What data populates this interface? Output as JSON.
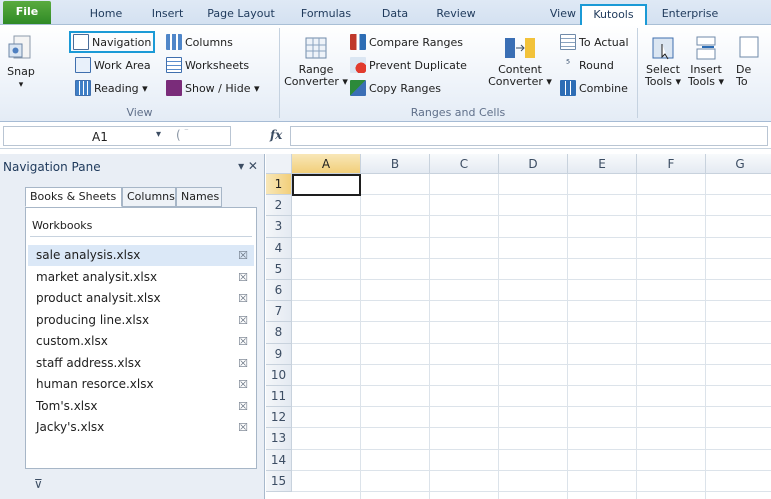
{
  "tabs": [
    "File",
    "Home",
    "Insert",
    "Page Layout",
    "Formulas",
    "Data",
    "Review",
    "View",
    "Kutools",
    "Enterprise"
  ],
  "ribbon": {
    "view_group": {
      "snap": "Snap",
      "navigation": "Navigation",
      "columns": "Columns",
      "work_area": "Work Area",
      "worksheets": "Worksheets",
      "reading": "Reading ▾",
      "show_hide": "Show / Hide ▾",
      "label": "View"
    },
    "ranges_group": {
      "range_converter_1": "Range",
      "range_converter_2": "Converter ▾",
      "compare_ranges": "Compare Ranges",
      "prevent_duplicate": "Prevent Duplicate",
      "copy_ranges": "Copy Ranges",
      "content_converter_1": "Content",
      "content_converter_2": "Converter ▾",
      "to_actual": "To Actual",
      "round": "Round",
      "combine": "Combine",
      "label": "Ranges and Cells"
    },
    "tools_group": {
      "select_1": "Select",
      "select_2": "Tools ▾",
      "insert_1": "Insert",
      "insert_2": "Tools ▾",
      "de_1": "De",
      "de_2": "To"
    }
  },
  "formula_bar": {
    "name_box": "A1",
    "fx": "fx"
  },
  "nav_pane": {
    "title": "Navigation Pane",
    "controls": "▾ ✕",
    "tabs": [
      "Books & Sheets",
      "Columns",
      "Names"
    ],
    "workbooks_label": "Workbooks",
    "workbooks": [
      "sale analysis.xlsx",
      "market analysit.xlsx",
      "product analysit.xlsx",
      "producing line.xlsx",
      "custom.xlsx",
      "staff address.xlsx",
      "human resorce.xlsx",
      "Tom's.xlsx",
      "Jacky's.xlsx"
    ],
    "close_glyph": "☒",
    "pin_glyph": "⊽"
  },
  "grid": {
    "columns": [
      "A",
      "B",
      "C",
      "D",
      "E",
      "F",
      "G"
    ],
    "rows": [
      "1",
      "2",
      "3",
      "4",
      "5",
      "6",
      "7",
      "8",
      "9",
      "10",
      "11",
      "12",
      "13",
      "14",
      "15"
    ],
    "active_cell": "A1"
  },
  "colors": {
    "accent": "#1b9ad6",
    "file_tab": "#3a9130",
    "selection": "#dbe8f7"
  }
}
